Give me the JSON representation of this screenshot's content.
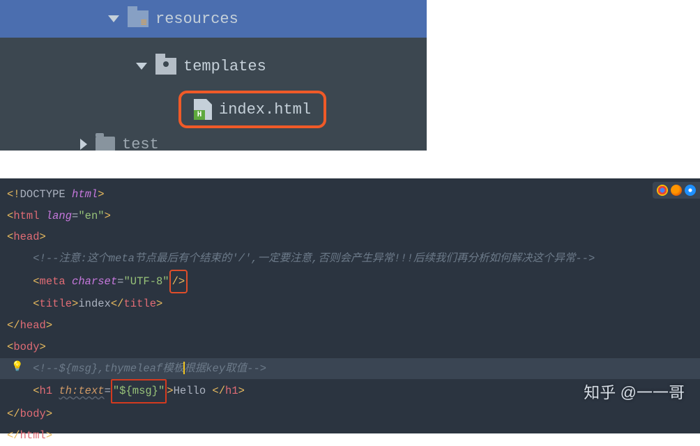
{
  "tree": {
    "resources": {
      "label": "resources",
      "expanded": true
    },
    "templates": {
      "label": "templates",
      "expanded": true
    },
    "index_html": {
      "label": "index.html"
    },
    "test": {
      "label": "test",
      "expanded": false
    }
  },
  "code": {
    "line1": {
      "p1": "<!",
      "p2": "DOCTYPE ",
      "p3": "html",
      "p4": ">"
    },
    "line2": {
      "p1": "<",
      "tag": "html ",
      "attr": "lang",
      "eq": "=",
      "val": "\"en\"",
      "p2": ">"
    },
    "line3": {
      "p1": "<",
      "tag": "head",
      "p2": ">"
    },
    "line4": {
      "comment": "<!--注意:这个meta节点最后有个结束的'/',一定要注意,否则会产生异常!!!后续我们再分析如何解决这个异常-->"
    },
    "line5": {
      "indent": "    ",
      "p1": "<",
      "tag": "meta ",
      "attr": "charset",
      "eq": "=",
      "val": "\"UTF-8\"",
      "close": "/>"
    },
    "line6": {
      "indent": "    ",
      "p1": "<",
      "tag": "title",
      "p2": ">",
      "text": "index",
      "p3": "</",
      "tag2": "title",
      "p4": ">"
    },
    "line7": {
      "p1": "</",
      "tag": "head",
      "p2": ">"
    },
    "line8": {
      "p1": "<",
      "tag": "body",
      "p2": ">"
    },
    "line9": {
      "indent": "    ",
      "comment_a": "<!--${msg},thymeleaf模板",
      "comment_b": "根据key取值-->"
    },
    "line10": {
      "indent": "    ",
      "p1": "<",
      "tag": "h1 ",
      "th_prefix": "th",
      "th_attr": ":text",
      "eq": "=",
      "val": "\"${msg}\"",
      "p2": ">",
      "text": "Hello ",
      "p3": "</",
      "tag2": "h1",
      "p4": ">"
    },
    "line11": {
      "p1": "</",
      "tag": "body",
      "p2": ">"
    },
    "line12": {
      "p1": "</",
      "tag": "html",
      "p2": ">"
    }
  },
  "watermark": "知乎 @一一哥"
}
